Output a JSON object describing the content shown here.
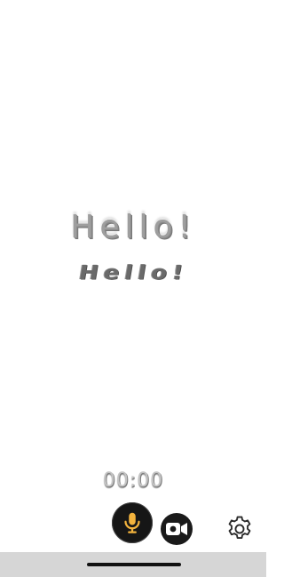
{
  "greeting": {
    "text": "Hello!",
    "reflection": "Hello!"
  },
  "timer": {
    "value": "00:00"
  },
  "controls": {
    "mic_icon": "microphone-icon",
    "video_icon": "video-camera-icon",
    "settings_icon": "gear-icon",
    "accent_color": "#f3b33d"
  }
}
